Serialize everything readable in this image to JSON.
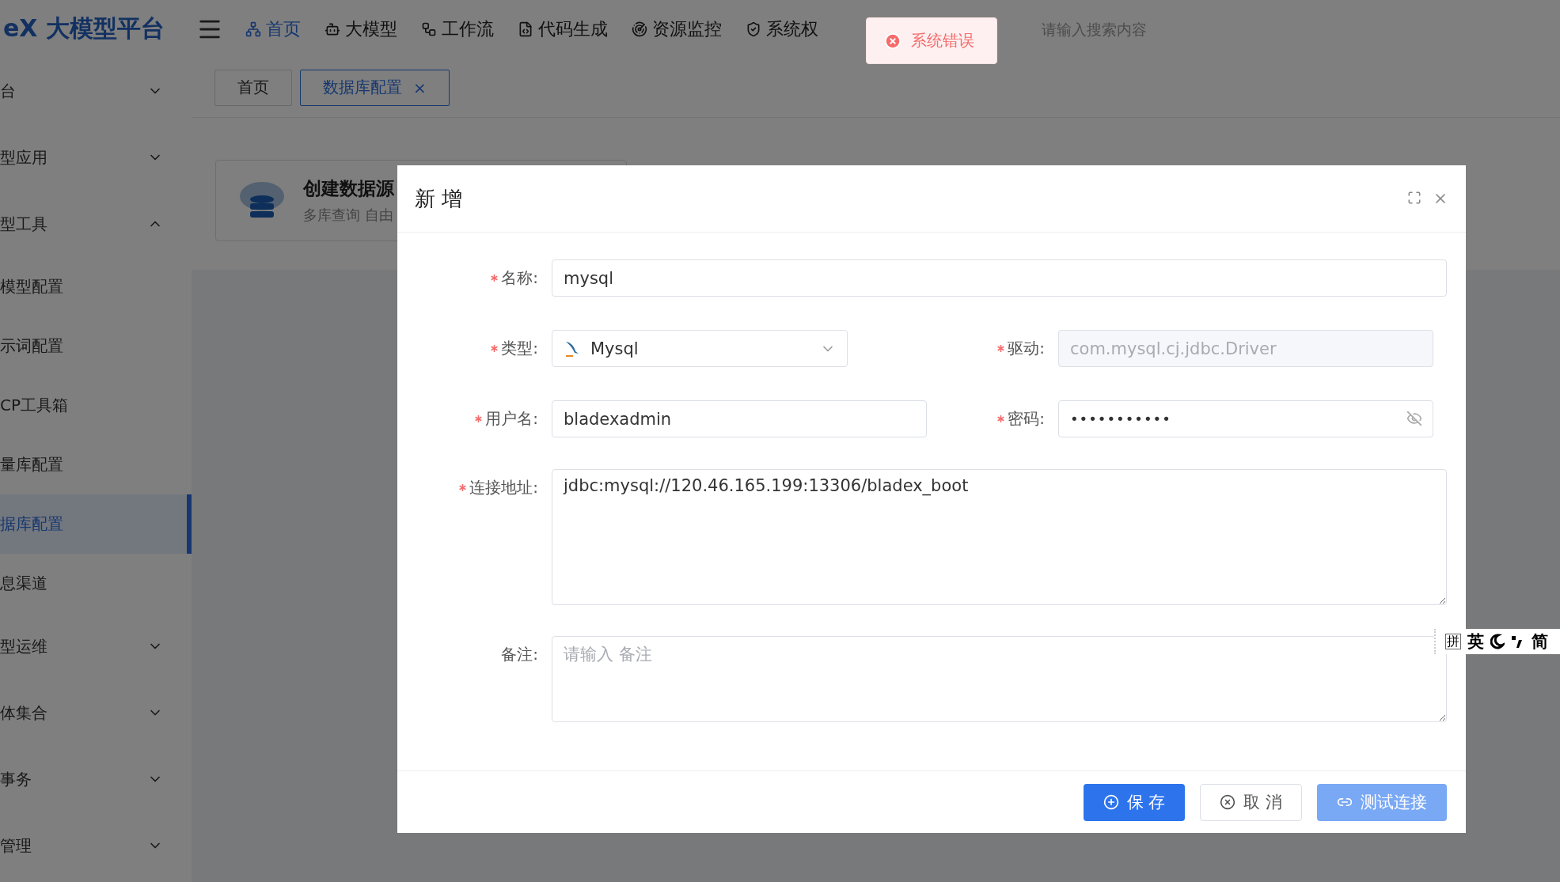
{
  "header": {
    "logo": "eX 大模型平台",
    "nav": [
      {
        "label": "首页",
        "selected": true
      },
      {
        "label": "大模型",
        "selected": false
      },
      {
        "label": "工作流",
        "selected": false
      },
      {
        "label": "代码生成",
        "selected": false
      },
      {
        "label": "资源监控",
        "selected": false
      },
      {
        "label": "系统权",
        "selected": false
      }
    ],
    "search": {
      "placeholder": "请输入搜索内容"
    }
  },
  "sidebar": {
    "items": [
      {
        "label": "台",
        "expanded": false
      },
      {
        "label": "型应用",
        "expanded": false
      },
      {
        "label": "型工具",
        "expanded": true,
        "children": [
          {
            "label": "模型配置",
            "selected": false
          },
          {
            "label": "示词配置",
            "selected": false
          },
          {
            "label": "CP工具箱",
            "selected": false
          },
          {
            "label": "量库配置",
            "selected": false
          },
          {
            "label": "据库配置",
            "selected": true
          },
          {
            "label": "息渠道",
            "selected": false
          }
        ]
      },
      {
        "label": "型运维",
        "expanded": false
      },
      {
        "label": "体集合",
        "expanded": false
      },
      {
        "label": "事务",
        "expanded": false
      },
      {
        "label": "管理",
        "expanded": false
      }
    ]
  },
  "tabs": [
    {
      "label": "首页",
      "selected": false
    },
    {
      "label": "数据库配置",
      "selected": true,
      "close": "×"
    }
  ],
  "card": {
    "title": "创建数据源",
    "subtitle": "多库查询 自由"
  },
  "toast": {
    "kind": "error",
    "text": "系统错误"
  },
  "dialog": {
    "title": "新 增",
    "rows": [
      [
        {
          "label": "名称:",
          "required": true,
          "kind": "text",
          "value": "mysql"
        }
      ],
      [
        {
          "label": "类型:",
          "required": true,
          "kind": "select",
          "value": "Mysql"
        },
        {
          "label": "驱动:",
          "required": true,
          "kind": "disabled",
          "value": "com.mysql.cj.jdbc.Driver"
        }
      ],
      [
        {
          "label": "用户名:",
          "required": true,
          "kind": "text",
          "value": "bladexadmin"
        },
        {
          "label": "密码:",
          "required": true,
          "kind": "password",
          "value": "•••••••••••"
        }
      ],
      [
        {
          "label": "连接地址:",
          "required": true,
          "kind": "textarea",
          "value": "jdbc:mysql://120.46.165.199:13306/bladex_boot"
        }
      ],
      [
        {
          "label": "备注:",
          "required": false,
          "kind": "note",
          "placeholder": "请输入 备注"
        }
      ]
    ],
    "buttons": [
      {
        "label": "保 存",
        "kind": "primary",
        "disabled": false
      },
      {
        "label": "取 消",
        "kind": "default",
        "disabled": false
      },
      {
        "label": "测试连接",
        "kind": "link",
        "disabled": true
      }
    ]
  },
  "ime_toolbar": {
    "items": [
      {
        "kind": "key",
        "label": "拼"
      },
      {
        "kind": "text",
        "label": "英"
      },
      {
        "kind": "moon"
      },
      {
        "kind": "punct"
      },
      {
        "kind": "text",
        "label": "简"
      }
    ]
  }
}
